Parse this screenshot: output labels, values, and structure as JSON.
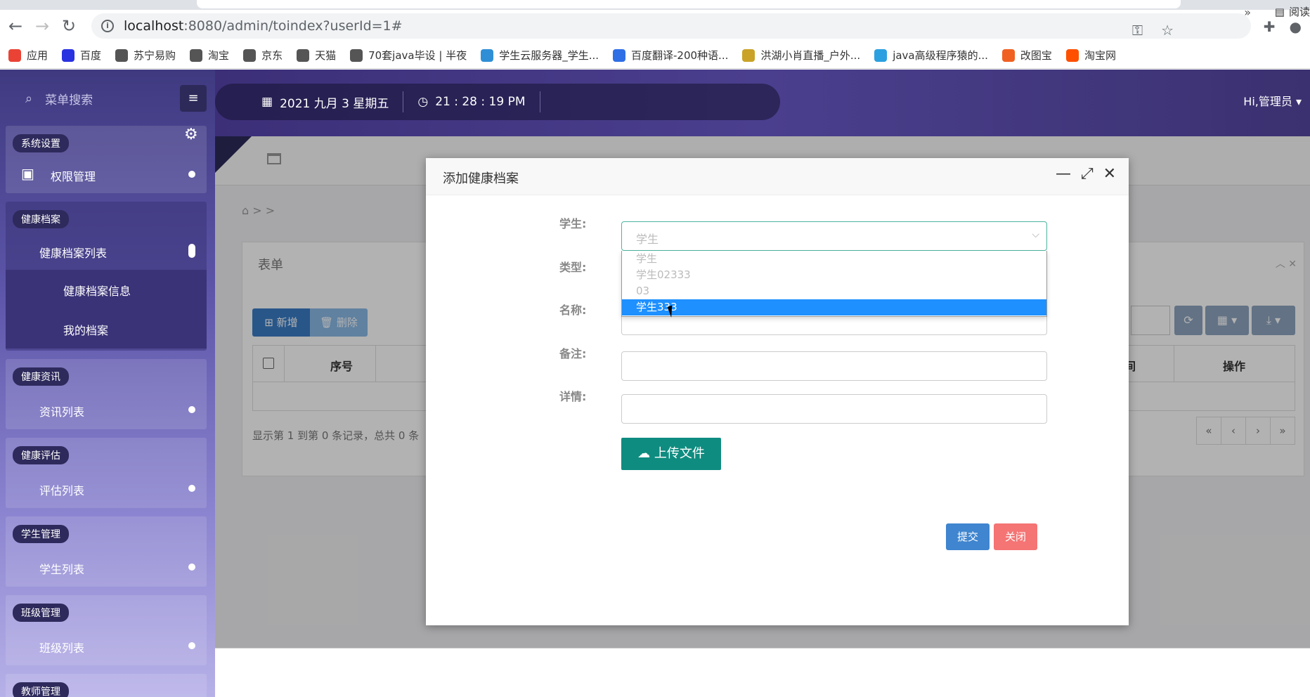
{
  "browser": {
    "url_host": "localhost",
    "url_path": ":8080/admin/toindex?userId=1#",
    "bookmarks": [
      {
        "label": "应用",
        "color": "#ea4335"
      },
      {
        "label": "百度",
        "color": "#2932e1"
      },
      {
        "label": "苏宁易购",
        "color": "#555555"
      },
      {
        "label": "淘宝",
        "color": "#555555"
      },
      {
        "label": "京东",
        "color": "#555555"
      },
      {
        "label": "天猫",
        "color": "#555555"
      },
      {
        "label": "70套java毕设 | 半夜",
        "color": "#555555"
      },
      {
        "label": "学生云服务器_学生...",
        "color": "#2f8fd6"
      },
      {
        "label": "百度翻译-200种语...",
        "color": "#2f6fe6"
      },
      {
        "label": "洪湖小肖直播_户外...",
        "color": "#c9a227"
      },
      {
        "label": "java高级程序猿的...",
        "color": "#2aa0e0"
      },
      {
        "label": "改图宝",
        "color": "#f06020"
      },
      {
        "label": "淘宝网",
        "color": "#ff5000"
      }
    ],
    "bookmarks_more": "»",
    "reading_list": "阅读"
  },
  "sidebar": {
    "search_placeholder": "菜单搜索",
    "groups": [
      {
        "title": "系统设置",
        "items": [
          "权限管理"
        ]
      },
      {
        "title": "健康档案",
        "items": [
          "健康档案列表"
        ],
        "sub": [
          "健康档案信息",
          "我的档案"
        ]
      },
      {
        "title": "健康资讯",
        "items": [
          "资讯列表"
        ]
      },
      {
        "title": "健康评估",
        "items": [
          "评估列表"
        ]
      },
      {
        "title": "学生管理",
        "items": [
          "学生列表"
        ]
      },
      {
        "title": "班级管理",
        "items": [
          "班级列表"
        ]
      },
      {
        "title": "教师管理",
        "items": []
      }
    ]
  },
  "topbar": {
    "date": "2021 九月 3 星期五",
    "time": "21 : 28 : 19 PM",
    "user": "Hi,管理员"
  },
  "content": {
    "breadcrumb": "> >",
    "panel_title": "表单",
    "add_label": "新增",
    "delete_label": "删除",
    "col_seq": "序号",
    "col_time_partial": "间",
    "col_op": "操作",
    "pager_info": "显示第 1 到第 0 条记录，总共 0 条",
    "pager_buttons": [
      "«",
      "‹",
      "›",
      "»"
    ]
  },
  "modal": {
    "title": "添加健康档案",
    "labels": {
      "student": "学生:",
      "type": "类型:",
      "name": "名称:",
      "note": "备注:",
      "detail": "详情:"
    },
    "student_placeholder": "学生",
    "options": [
      "学生",
      "学生02333",
      "03",
      "学生333"
    ],
    "selected_index": 3,
    "upload_label": "上传文件",
    "submit_label": "提交",
    "close_label": "关闭"
  }
}
